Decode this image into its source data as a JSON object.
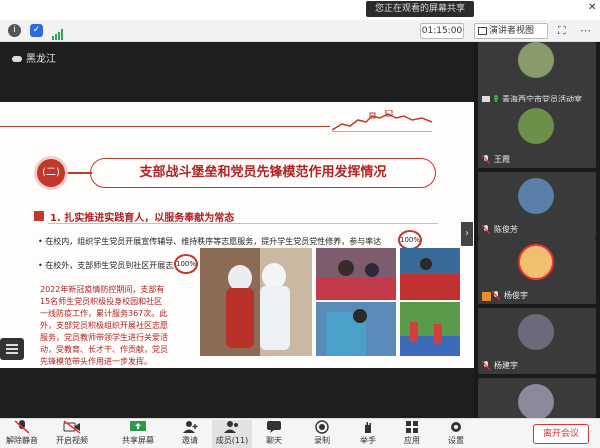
{
  "top": {
    "share_banner": "您正在观看的屏幕共享",
    "close": "✕"
  },
  "meetbar": {
    "timer": "01:15:00",
    "view_button": "演讲者视图"
  },
  "share": {
    "title": "黑龙江"
  },
  "slide": {
    "section_number": "(二)",
    "heading": "支部战斗堡垒和党员先锋模范作用发挥情况",
    "subheading": "1. 扎实推进实践育人，以服务奉献为常态",
    "bullet1": "在校内，组织学生党员开展宣传辅导、维持秩序等志愿服务，提升学生党员党性修养，参与率达",
    "bullet1_pct": "100%",
    "bullet2": "在校外，支部师生党员到社区开展志愿服务，参与率达",
    "bullet2_pct": "100%",
    "red_paragraph": "2022年新冠疫情防控期间，支部有15名师生党员积极投身校园和社区一线防疫工作，累计服务367次。此外，支部党员积极组织开展社区志愿服务，党员教师带领学生进行关爱活动，受教育、长才干、作贡献，党员先锋模范带头作用进一步发挥。"
  },
  "participants": [
    {
      "name": "青海西宁市党员活动室",
      "avatar_color": "#8a9a6a",
      "muted": false
    },
    {
      "name": "王霞",
      "avatar_color": "#6c8f4a",
      "muted": true
    },
    {
      "name": "陈俊芳",
      "avatar_color": "#5a7fa8",
      "muted": true
    },
    {
      "name": "杨俊宇",
      "avatar_color": "#f0c070",
      "muted": true
    },
    {
      "name": "杨建宇",
      "avatar_color": "#6a6a7a",
      "muted": true
    },
    {
      "name": "",
      "avatar_color": "#8a8a9a",
      "muted": false
    }
  ],
  "toolbar": {
    "items": [
      {
        "label": "解除静音",
        "icon": "mic-muted-icon"
      },
      {
        "label": "开启视频",
        "icon": "video-off-icon"
      },
      {
        "label": "共享屏幕",
        "icon": "share-screen-icon"
      },
      {
        "label": "邀请",
        "icon": "invite-icon"
      },
      {
        "label": "成员(11)",
        "icon": "members-icon"
      },
      {
        "label": "聊天",
        "icon": "chat-icon"
      },
      {
        "label": "录制",
        "icon": "record-icon"
      },
      {
        "label": "举手",
        "icon": "raise-hand-icon"
      },
      {
        "label": "应用",
        "icon": "apps-icon"
      },
      {
        "label": "设置",
        "icon": "settings-icon"
      }
    ],
    "leave": "离开会议"
  }
}
